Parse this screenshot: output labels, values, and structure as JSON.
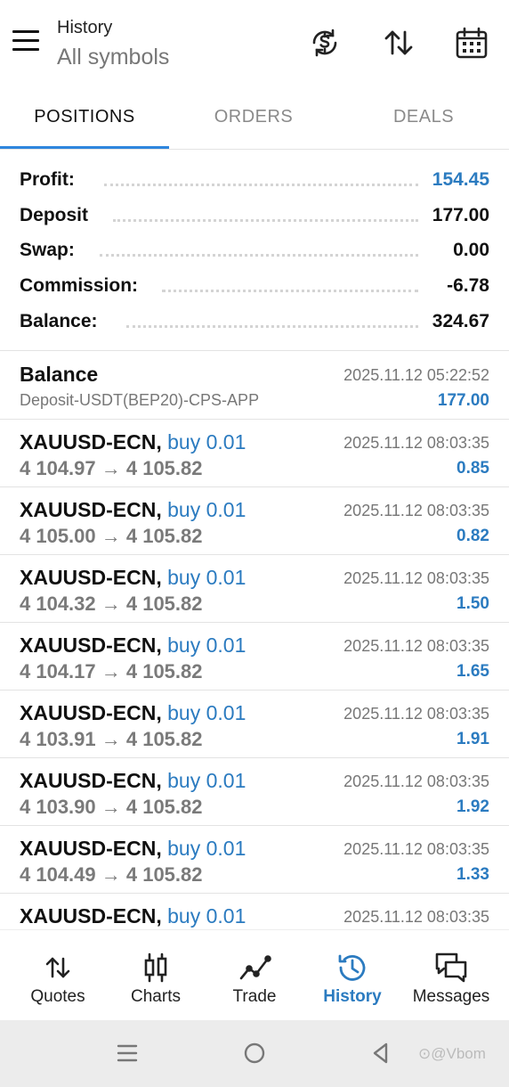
{
  "header": {
    "title": "History",
    "subtitle": "All symbols",
    "icons": [
      "menu-icon",
      "currency-refresh-icon",
      "sort-icon",
      "calendar-icon"
    ]
  },
  "tabs": [
    {
      "label": "POSITIONS",
      "active": true
    },
    {
      "label": "ORDERS",
      "active": false
    },
    {
      "label": "DEALS",
      "active": false
    }
  ],
  "summary": [
    {
      "label": "Profit:",
      "value": "154.45",
      "highlight": true
    },
    {
      "label": "Deposit",
      "value": "177.00",
      "highlight": false
    },
    {
      "label": "Swap:",
      "value": "0.00",
      "highlight": false
    },
    {
      "label": "Commission:",
      "value": "-6.78",
      "highlight": false
    },
    {
      "label": "Balance:",
      "value": "324.67",
      "highlight": false
    }
  ],
  "balance_entry": {
    "title": "Balance",
    "description": "Deposit-USDT(BEP20)-CPS-APP",
    "time": "2025.11.12 05:22:52",
    "amount": "177.00"
  },
  "positions": [
    {
      "symbol": "XAUUSD-ECN,",
      "side": "buy 0.01",
      "prices": "4 104.97 → 4 105.82",
      "time": "2025.11.12 08:03:35",
      "profit": "0.85"
    },
    {
      "symbol": "XAUUSD-ECN,",
      "side": "buy 0.01",
      "prices": "4 105.00 → 4 105.82",
      "time": "2025.11.12 08:03:35",
      "profit": "0.82"
    },
    {
      "symbol": "XAUUSD-ECN,",
      "side": "buy 0.01",
      "prices": "4 104.32 → 4 105.82",
      "time": "2025.11.12 08:03:35",
      "profit": "1.50"
    },
    {
      "symbol": "XAUUSD-ECN,",
      "side": "buy 0.01",
      "prices": "4 104.17 → 4 105.82",
      "time": "2025.11.12 08:03:35",
      "profit": "1.65"
    },
    {
      "symbol": "XAUUSD-ECN,",
      "side": "buy 0.01",
      "prices": "4 103.91 → 4 105.82",
      "time": "2025.11.12 08:03:35",
      "profit": "1.91"
    },
    {
      "symbol": "XAUUSD-ECN,",
      "side": "buy 0.01",
      "prices": "4 103.90 → 4 105.82",
      "time": "2025.11.12 08:03:35",
      "profit": "1.92"
    },
    {
      "symbol": "XAUUSD-ECN,",
      "side": "buy 0.01",
      "prices": "4 104.49 → 4 105.82",
      "time": "2025.11.12 08:03:35",
      "profit": "1.33"
    },
    {
      "symbol": "XAUUSD-ECN,",
      "side": "buy 0.01",
      "prices": "",
      "time": "2025.11.12 08:03:35",
      "profit": ""
    }
  ],
  "bottom_nav": [
    {
      "label": "Quotes",
      "icon": "quotes-icon",
      "active": false
    },
    {
      "label": "Charts",
      "icon": "charts-icon",
      "active": false
    },
    {
      "label": "Trade",
      "icon": "trade-icon",
      "active": false
    },
    {
      "label": "History",
      "icon": "history-icon",
      "active": true
    },
    {
      "label": "Messages",
      "icon": "messages-icon",
      "active": false
    }
  ],
  "system_nav": {
    "watermark": "⊙@Vbom"
  },
  "colors": {
    "accent": "#2b7bc0",
    "tab_underline": "#2e86de",
    "muted": "#7a7a7a"
  }
}
